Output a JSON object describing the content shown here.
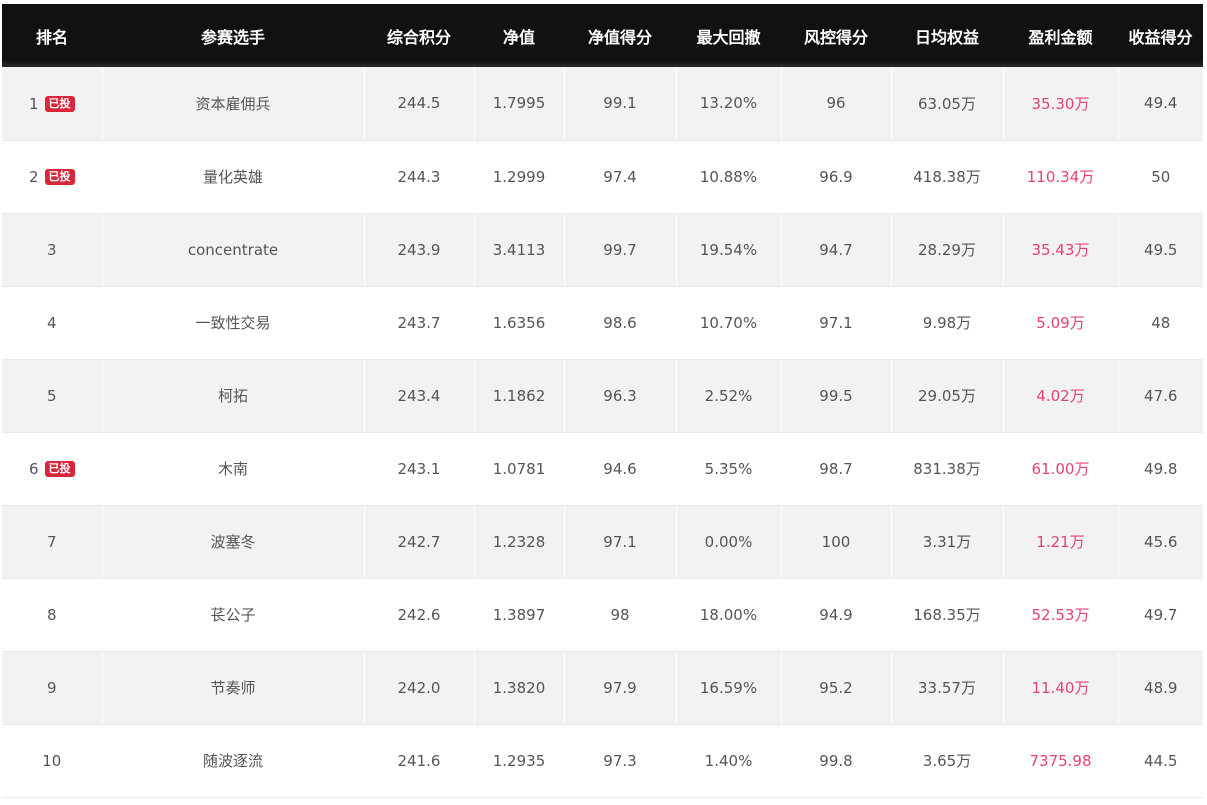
{
  "table": {
    "headers": [
      "排名",
      "参赛选手",
      "综合积分",
      "净值",
      "净值得分",
      "最大回撤",
      "风控得分",
      "日均权益",
      "盈利金额",
      "收益得分"
    ],
    "badge_label": "已投",
    "colors": {
      "header_bg": "#111111",
      "profit_text": "#e8407a",
      "badge_bg": "#d9263a",
      "row_alt_bg": "#f2f2f2"
    },
    "rows": [
      {
        "rank": "1",
        "badge": true,
        "name": "资本雇佣兵",
        "score": "244.5",
        "nav": "1.7995",
        "nav_score": "99.1",
        "max_drawdown": "13.20%",
        "risk_score": "96",
        "avg_equity": "63.05万",
        "profit": "35.30万",
        "return_score": "49.4"
      },
      {
        "rank": "2",
        "badge": true,
        "name": "量化英雄",
        "score": "244.3",
        "nav": "1.2999",
        "nav_score": "97.4",
        "max_drawdown": "10.88%",
        "risk_score": "96.9",
        "avg_equity": "418.38万",
        "profit": "110.34万",
        "return_score": "50"
      },
      {
        "rank": "3",
        "badge": false,
        "name": "concentrate",
        "score": "243.9",
        "nav": "3.4113",
        "nav_score": "99.7",
        "max_drawdown": "19.54%",
        "risk_score": "94.7",
        "avg_equity": "28.29万",
        "profit": "35.43万",
        "return_score": "49.5"
      },
      {
        "rank": "4",
        "badge": false,
        "name": "一致性交易",
        "score": "243.7",
        "nav": "1.6356",
        "nav_score": "98.6",
        "max_drawdown": "10.70%",
        "risk_score": "97.1",
        "avg_equity": "9.98万",
        "profit": "5.09万",
        "return_score": "48"
      },
      {
        "rank": "5",
        "badge": false,
        "name": "柯拓",
        "score": "243.4",
        "nav": "1.1862",
        "nav_score": "96.3",
        "max_drawdown": "2.52%",
        "risk_score": "99.5",
        "avg_equity": "29.05万",
        "profit": "4.02万",
        "return_score": "47.6"
      },
      {
        "rank": "6",
        "badge": true,
        "name": "木南",
        "score": "243.1",
        "nav": "1.0781",
        "nav_score": "94.6",
        "max_drawdown": "5.35%",
        "risk_score": "98.7",
        "avg_equity": "831.38万",
        "profit": "61.00万",
        "return_score": "49.8"
      },
      {
        "rank": "7",
        "badge": false,
        "name": "波塞冬",
        "score": "242.7",
        "nav": "1.2328",
        "nav_score": "97.1",
        "max_drawdown": "0.00%",
        "risk_score": "100",
        "avg_equity": "3.31万",
        "profit": "1.21万",
        "return_score": "45.6"
      },
      {
        "rank": "8",
        "badge": false,
        "name": "苌公子",
        "score": "242.6",
        "nav": "1.3897",
        "nav_score": "98",
        "max_drawdown": "18.00%",
        "risk_score": "94.9",
        "avg_equity": "168.35万",
        "profit": "52.53万",
        "return_score": "49.7"
      },
      {
        "rank": "9",
        "badge": false,
        "name": "节奏师",
        "score": "242.0",
        "nav": "1.3820",
        "nav_score": "97.9",
        "max_drawdown": "16.59%",
        "risk_score": "95.2",
        "avg_equity": "33.57万",
        "profit": "11.40万",
        "return_score": "48.9"
      },
      {
        "rank": "10",
        "badge": false,
        "name": "随波逐流",
        "score": "241.6",
        "nav": "1.2935",
        "nav_score": "97.3",
        "max_drawdown": "1.40%",
        "risk_score": "99.8",
        "avg_equity": "3.65万",
        "profit": "7375.98",
        "return_score": "44.5"
      }
    ]
  }
}
